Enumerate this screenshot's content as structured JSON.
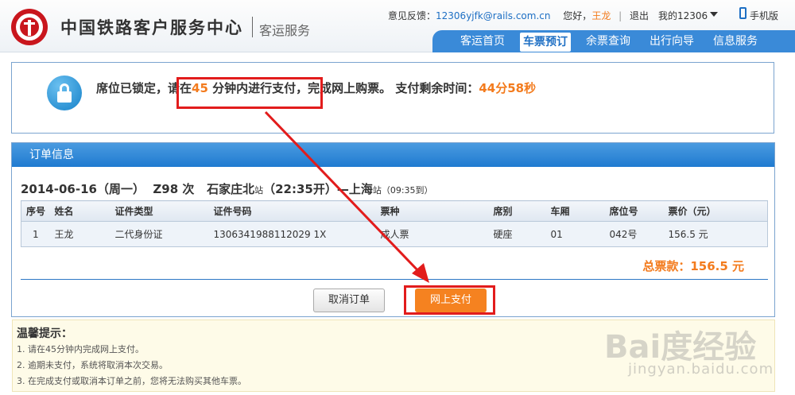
{
  "header": {
    "logo_text": "中国铁路客户服务中心",
    "logo_sub": "客运服务",
    "feedback_label": "意见反馈：",
    "feedback_email": "12306yjfk@rails.com.cn",
    "greeting": "您好，",
    "user": "王龙",
    "logout": "退出",
    "my12306": "我的12306",
    "mobile": "手机版"
  },
  "nav": {
    "items": [
      "客运首页",
      "车票预订",
      "余票查询",
      "出行向导",
      "信息服务"
    ],
    "active": "车票预订"
  },
  "lock": {
    "msg_prefix": "席位已锁定，",
    "msg_pay_pre": "请在",
    "minutes": "45",
    "msg_pay_post": " 分钟内进行支付，",
    "msg_mid": "完成网上购票。 支付剩余时间：",
    "remaining": "44分58秒"
  },
  "order": {
    "title": "订单信息",
    "date": "2014-06-16（周一）",
    "train": "Z98 次",
    "from": "石家庄北",
    "from_suffix": "站",
    "depart": "（22:35开）",
    "dash": "—",
    "to": "上海",
    "to_suffix": "站",
    "arrive": "（09:35到）",
    "columns": [
      "序号",
      "姓名",
      "证件类型",
      "证件号码",
      "票种",
      "席别",
      "车厢",
      "席位号",
      "票价（元）"
    ],
    "rows": [
      [
        "1",
        "王龙",
        "二代身份证",
        "1306341988112029 1X",
        "成人票",
        "硬座",
        "01",
        "042号",
        "156.5 元"
      ]
    ],
    "total": "总票款：156.5 元",
    "cancel_label": "取消订单",
    "pay_label": "网上支付"
  },
  "tips": {
    "title": "温馨提示：",
    "items": [
      "1.  请在45分钟内完成网上支付。",
      "2.  逾期未支付，系统将取消本次交易。",
      "3.  在完成支付或取消本订单之前，您将无法购买其他车票。"
    ]
  },
  "watermark": {
    "brand": "Bai度经验",
    "url": "jingyan.baidu.com"
  },
  "colors": {
    "accent_orange": "#f37b1d",
    "nav_blue": "#3a8ad8",
    "highlight_red": "#e21c1c"
  }
}
